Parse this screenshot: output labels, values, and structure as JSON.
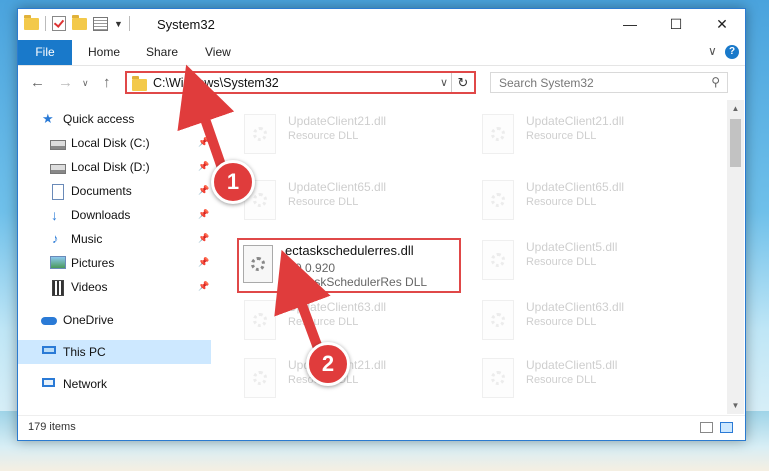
{
  "window": {
    "title": "System32",
    "controls": {
      "minimize": "—",
      "maximize": "☐",
      "close": "✕"
    }
  },
  "ribbon": {
    "tabs": [
      "File",
      "Home",
      "Share",
      "View"
    ],
    "expand_glyph": "∨",
    "help_glyph": "?"
  },
  "address": {
    "path": "C:\\Windows\\System32",
    "search_placeholder": "Search System32"
  },
  "sidebar": {
    "items": [
      {
        "label": "Quick access",
        "icon": "star-icon",
        "pinned": false
      },
      {
        "label": "Local Disk (C:)",
        "icon": "disk-icon",
        "pinned": true
      },
      {
        "label": "Local Disk (D:)",
        "icon": "disk-icon",
        "pinned": true
      },
      {
        "label": "Documents",
        "icon": "document-icon",
        "pinned": true
      },
      {
        "label": "Downloads",
        "icon": "download-icon",
        "pinned": true
      },
      {
        "label": "Music",
        "icon": "music-icon",
        "pinned": true
      },
      {
        "label": "Pictures",
        "icon": "pictures-icon",
        "pinned": true
      },
      {
        "label": "Videos",
        "icon": "video-icon",
        "pinned": true
      },
      {
        "label": "OneDrive",
        "icon": "cloud-icon",
        "pinned": false
      },
      {
        "label": "This PC",
        "icon": "computer-icon",
        "pinned": false,
        "selected": true
      },
      {
        "label": "Network",
        "icon": "network-icon",
        "pinned": false
      }
    ]
  },
  "files": {
    "left": [
      {
        "name": "UpdateClient21.dll",
        "type": "Resource DLL"
      },
      {
        "name": "UpdateClient65.dll",
        "type": "Resource DLL"
      },
      {
        "name": "UpdateClient63.dll",
        "type": "Resource DLL"
      },
      {
        "name": "UpdateClient21.dll",
        "type": "Resource DLL"
      }
    ],
    "right": [
      {
        "name": "UpdateClient21.dll",
        "type": "Resource DLL"
      },
      {
        "name": "UpdateClient65.dll",
        "type": "Resource DLL"
      },
      {
        "name": "UpdateClient5.dll",
        "type": "Resource DLL"
      },
      {
        "name": "UpdateClient63.dll",
        "type": "Resource DLL"
      },
      {
        "name": "UpdateClient5.dll",
        "type": "Resource DLL"
      }
    ],
    "highlighted": {
      "name": "ectaskschedulerres.dll",
      "version": "7.0.0.920",
      "description": "ECTaskSchedulerRes DLL"
    }
  },
  "status": {
    "item_count": "179 items"
  },
  "callouts": [
    "1",
    "2"
  ],
  "colors": {
    "accent": "#1979ca",
    "highlight": "#e04848",
    "selected": "#cde8ff"
  }
}
